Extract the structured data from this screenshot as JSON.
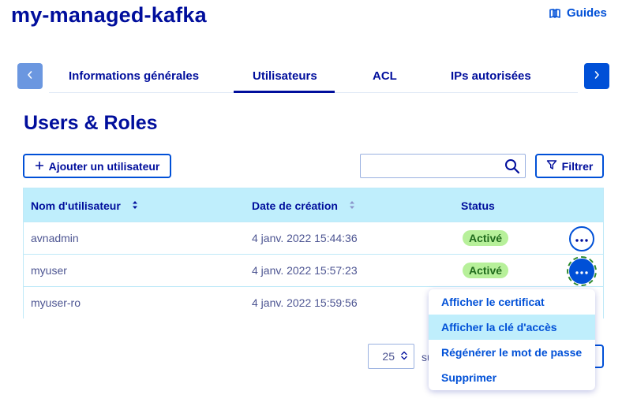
{
  "header": {
    "title": "my-managed-kafka",
    "guides_label": "Guides",
    "guides_icon": "book-icon"
  },
  "tabs": [
    {
      "label": "Informations générales",
      "active": false
    },
    {
      "label": "Utilisateurs",
      "active": true
    },
    {
      "label": "ACL",
      "active": false
    },
    {
      "label": "IPs autorisées",
      "active": false
    }
  ],
  "section": {
    "title": "Users & Roles",
    "add_button_label": "Ajouter un utilisateur",
    "search_value": "",
    "filter_label": "Filtrer"
  },
  "table": {
    "columns": [
      "Nom d'utilisateur",
      "Date de création",
      "Status"
    ],
    "rows": [
      {
        "username": "avnadmin",
        "created": "4 janv. 2022 15:44:36",
        "status": "Activé"
      },
      {
        "username": "myuser",
        "created": "4 janv. 2022 15:57:23",
        "status": "Activé"
      },
      {
        "username": "myuser-ro",
        "created": "4 janv. 2022 15:59:56",
        "status": ""
      }
    ]
  },
  "action_menu": {
    "items": [
      "Afficher le certificat",
      "Afficher la clé d'accès",
      "Régénérer le mot de passe",
      "Supprimer"
    ],
    "hovered_index": 1
  },
  "pagination": {
    "page_size": "25",
    "suffix": "su"
  },
  "colors": {
    "primary": "#0050d7",
    "title": "#000e9c",
    "header_bg": "#bfeefc",
    "badge_bg": "#b7f09a",
    "badge_text": "#1f6b1c"
  }
}
